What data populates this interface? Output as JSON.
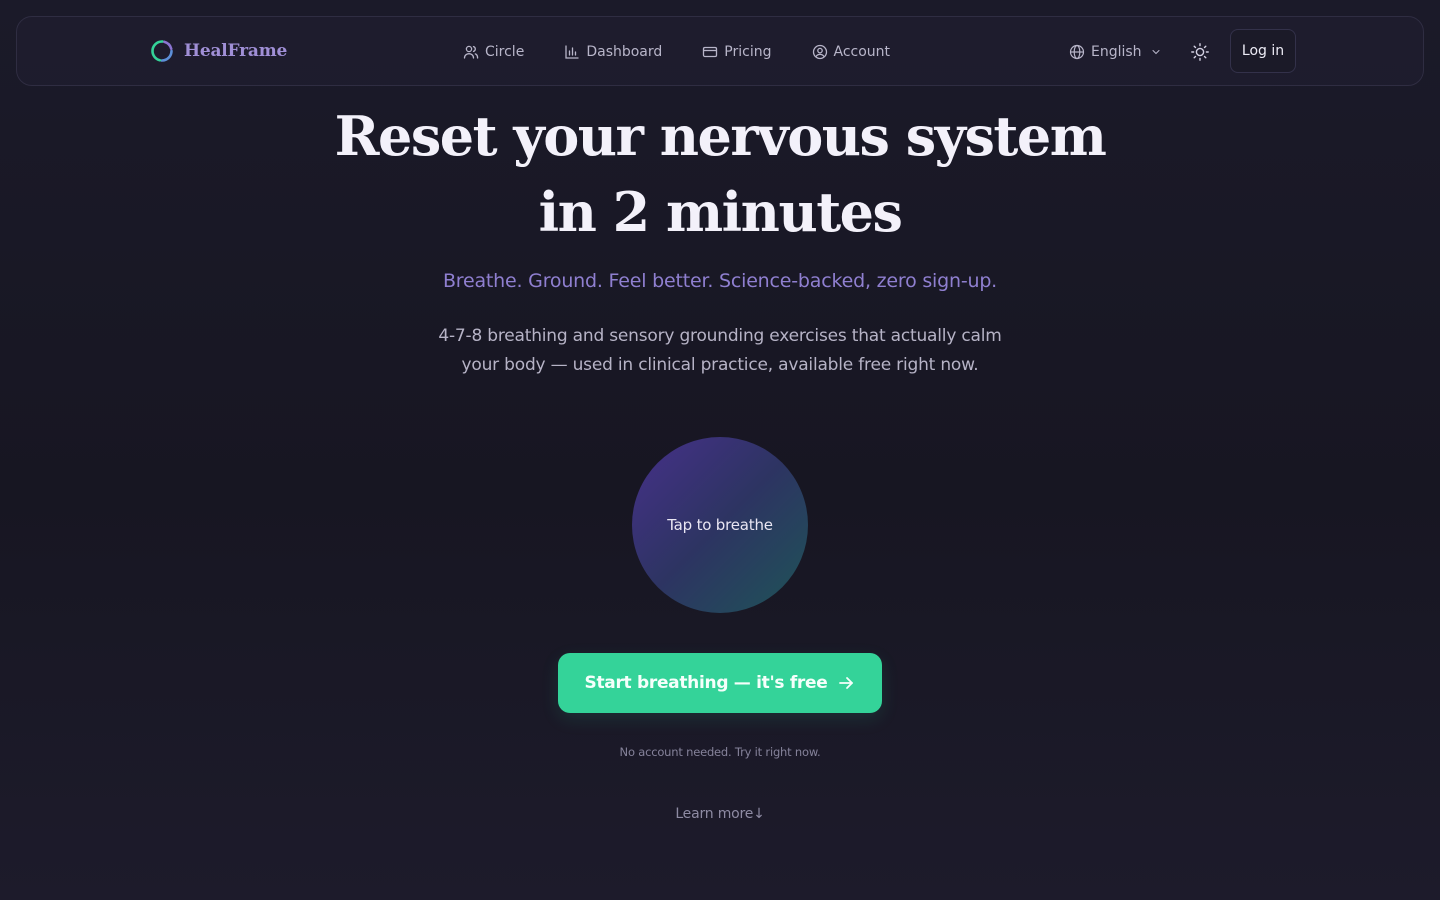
{
  "brand": {
    "name": "HealFrame",
    "icon": "ring-logo-icon"
  },
  "nav": {
    "items": [
      {
        "label": "Circle",
        "icon": "people-icon"
      },
      {
        "label": "Dashboard",
        "icon": "bar-chart-icon"
      },
      {
        "label": "Pricing",
        "icon": "credit-card-icon"
      },
      {
        "label": "Account",
        "icon": "user-circle-icon"
      }
    ],
    "language": "English",
    "language_icon": "globe-icon",
    "theme_icon": "sun-icon",
    "login_label": "Log in"
  },
  "hero": {
    "title_line1": "Reset your nervous system",
    "title_line2": "in 2 minutes",
    "tagline": "Breathe. Ground. Feel better. Science-backed, zero sign-up.",
    "description_line1": "4-7-8 breathing and sensory grounding exercises that actually calm",
    "description_line2": "your body — used in clinical practice, available free right now.",
    "breath_button": "Tap to breathe",
    "cta_label": "Start breathing — it's free",
    "cta_icon": "arrow-right-icon",
    "note": "No account needed. Try it right now.",
    "learn_more": "Learn more↓"
  },
  "colors": {
    "background": "#1b1a29",
    "brand": "#a08fd6",
    "accent": "#34d399",
    "tagline": "#8f7fd0"
  }
}
